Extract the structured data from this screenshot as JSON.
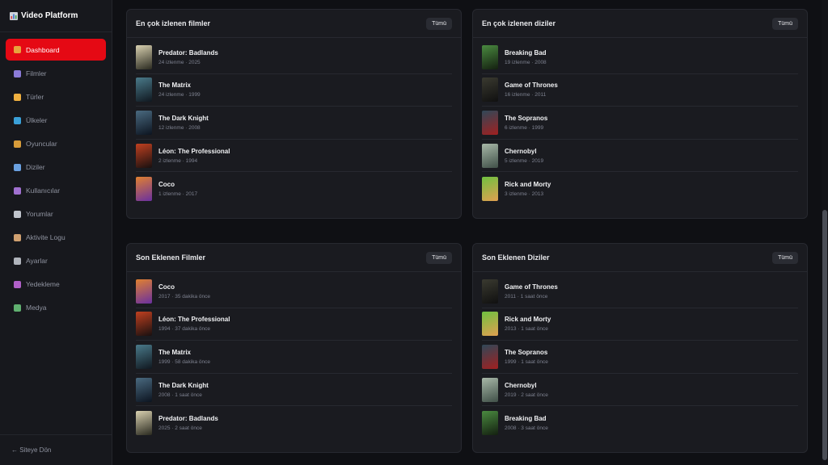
{
  "app": {
    "title": "Video Platform"
  },
  "sidebar": {
    "items": [
      {
        "label": "Dashboard",
        "icon": "home-icon",
        "color": "#e8a33d"
      },
      {
        "label": "Filmler",
        "icon": "film-icon",
        "color": "#8b7bd8"
      },
      {
        "label": "Türler",
        "icon": "tag-icon",
        "color": "#f0b040"
      },
      {
        "label": "Ülkeler",
        "icon": "globe-icon",
        "color": "#3aa0d8"
      },
      {
        "label": "Oyuncular",
        "icon": "actors-icon",
        "color": "#d89c3a"
      },
      {
        "label": "Diziler",
        "icon": "tv-icon",
        "color": "#6aa0e0"
      },
      {
        "label": "Kullanıcılar",
        "icon": "user-icon",
        "color": "#a070d0"
      },
      {
        "label": "Yorumlar",
        "icon": "comment-icon",
        "color": "#c0c4cc"
      },
      {
        "label": "Aktivite Logu",
        "icon": "clipboard-icon",
        "color": "#d0a070"
      },
      {
        "label": "Ayarlar",
        "icon": "gear-icon",
        "color": "#b0b4bc"
      },
      {
        "label": "Yedekleme",
        "icon": "save-icon",
        "color": "#b060c8"
      },
      {
        "label": "Medya",
        "icon": "image-icon",
        "color": "#60b070"
      }
    ],
    "footer": "← Siteye Dön"
  },
  "cards": {
    "top_movies": {
      "title": "En çok izlenen filmler",
      "button": "Tümü",
      "items": [
        {
          "title": "Predator: Badlands",
          "sub": "24 izlenme · 2025",
          "poster": [
            "#d8d0b0",
            "#2a2a20"
          ]
        },
        {
          "title": "The Matrix",
          "sub": "24 izlenme · 1999",
          "poster": [
            "#4a7a8a",
            "#101820"
          ]
        },
        {
          "title": "The Dark Knight",
          "sub": "12 izlenme · 2008",
          "poster": [
            "#4a6a80",
            "#0c1420"
          ]
        },
        {
          "title": "Léon: The Professional",
          "sub": "2 izlenme · 1994",
          "poster": [
            "#c04020",
            "#181010"
          ]
        },
        {
          "title": "Coco",
          "sub": "1 izlenme · 2017",
          "poster": [
            "#e08030",
            "#6a30a0"
          ]
        }
      ]
    },
    "top_series": {
      "title": "En çok izlenen diziler",
      "button": "Tümü",
      "items": [
        {
          "title": "Breaking Bad",
          "sub": "19 izlenme · 2008",
          "poster": [
            "#4a8a40",
            "#142010"
          ]
        },
        {
          "title": "Game of Thrones",
          "sub": "16 izlenme · 2011",
          "poster": [
            "#3a3a30",
            "#101010"
          ]
        },
        {
          "title": "The Sopranos",
          "sub": "6 izlenme · 1999",
          "poster": [
            "#304858",
            "#a02020"
          ]
        },
        {
          "title": "Chernobyl",
          "sub": "5 izlenme · 2019",
          "poster": [
            "#a8b8a8",
            "#405048"
          ]
        },
        {
          "title": "Rick and Morty",
          "sub": "3 izlenme · 2013",
          "poster": [
            "#70c040",
            "#e0a050"
          ]
        }
      ]
    },
    "recent_movies": {
      "title": "Son Eklenen Filmler",
      "button": "Tümü",
      "items": [
        {
          "title": "Coco",
          "sub": "2017 · 35 dakika önce",
          "poster": [
            "#e08030",
            "#6a30a0"
          ]
        },
        {
          "title": "Léon: The Professional",
          "sub": "1994 · 37 dakika önce",
          "poster": [
            "#c04020",
            "#181010"
          ]
        },
        {
          "title": "The Matrix",
          "sub": "1999 · 58 dakika önce",
          "poster": [
            "#4a7a8a",
            "#101820"
          ]
        },
        {
          "title": "The Dark Knight",
          "sub": "2008 · 1 saat önce",
          "poster": [
            "#4a6a80",
            "#0c1420"
          ]
        },
        {
          "title": "Predator: Badlands",
          "sub": "2025 · 2 saat önce",
          "poster": [
            "#d8d0b0",
            "#2a2a20"
          ]
        }
      ]
    },
    "recent_series": {
      "title": "Son Eklenen Diziler",
      "button": "Tümü",
      "items": [
        {
          "title": "Game of Thrones",
          "sub": "2011 · 1 saat önce",
          "poster": [
            "#3a3a30",
            "#101010"
          ]
        },
        {
          "title": "Rick and Morty",
          "sub": "2013 · 1 saat önce",
          "poster": [
            "#70c040",
            "#e0a050"
          ]
        },
        {
          "title": "The Sopranos",
          "sub": "1999 · 1 saat önce",
          "poster": [
            "#304858",
            "#a02020"
          ]
        },
        {
          "title": "Chernobyl",
          "sub": "2019 · 2 saat önce",
          "poster": [
            "#a8b8a8",
            "#405048"
          ]
        },
        {
          "title": "Breaking Bad",
          "sub": "2008 · 3 saat önce",
          "poster": [
            "#4a8a40",
            "#142010"
          ]
        }
      ]
    }
  }
}
